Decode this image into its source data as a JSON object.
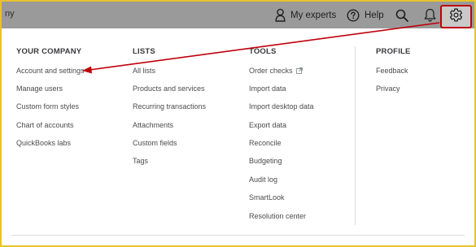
{
  "topbar": {
    "company_name": "ny",
    "experts_label": "My experts",
    "help_label": "Help"
  },
  "icons": {
    "experts": "person-icon",
    "help": "question-circle-icon",
    "search": "search-icon",
    "bell": "bell-icon",
    "gear": "gear-icon",
    "external": "external-link-icon"
  },
  "colors": {
    "border_highlight": "#e8c22c",
    "annotation_red": "#c0000a",
    "topbar_bg": "#9a9a9a"
  },
  "menu": {
    "your_company": {
      "heading": "YOUR COMPANY",
      "items": [
        "Account and settings",
        "Manage users",
        "Custom form styles",
        "Chart of accounts",
        "QuickBooks labs"
      ]
    },
    "lists": {
      "heading": "LISTS",
      "items": [
        "All lists",
        "Products and services",
        "Recurring transactions",
        "Attachments",
        "Custom fields",
        "Tags"
      ]
    },
    "tools": {
      "heading": "TOOLS",
      "items": [
        "Order checks",
        "Import data",
        "Import desktop data",
        "Export data",
        "Reconcile",
        "Budgeting",
        "Audit log",
        "SmartLook",
        "Resolution center"
      ]
    },
    "profile": {
      "heading": "PROFILE",
      "items": [
        "Feedback",
        "Privacy"
      ]
    }
  }
}
